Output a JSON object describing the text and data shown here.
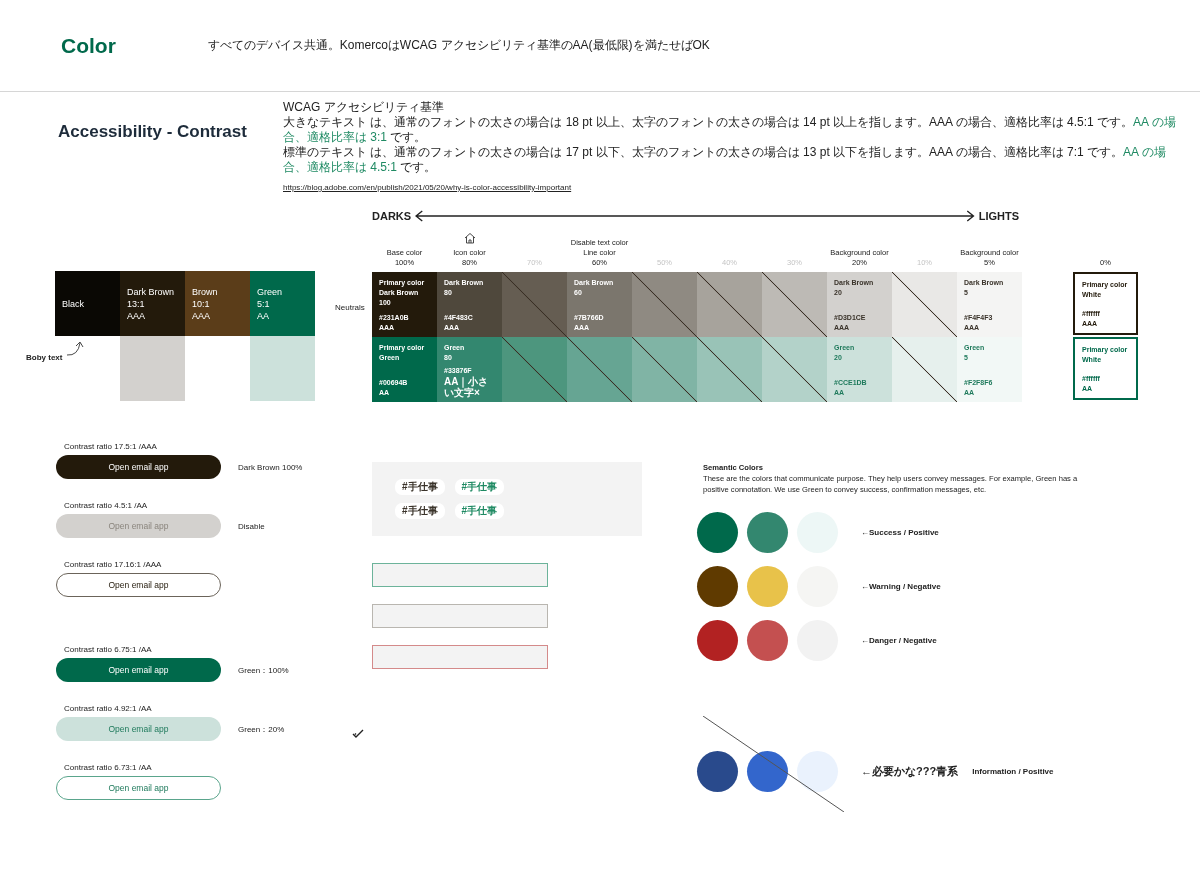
{
  "header": {
    "title": "Color",
    "note": "すべてのデバイス共通。KomercoはWCAG アクセシビリティ基準のAA(最低限)を満たせばOK"
  },
  "section_title": "Accessibility - Contrast",
  "wcag": {
    "heading": "WCAG アクセシビリティ基準",
    "lines": [
      {
        "text": "大きなテキスト は、通常のフォントの太さの場合は 18 pt 以上、太字のフォントの太さの場合は 14 pt 以上を指します。AAA の場合、適格比率は 4.5:1 です。",
        "highlight": "AA の場合、適格比率は 3:1",
        "tail": " です。"
      },
      {
        "text": "標準のテキスト は、通常のフォントの太さの場合は 17 pt 以下、太字のフォントの太さの場合は 13 pt 以下を指します。AAA の場合、適格比率は 7:1 です。",
        "highlight": "AA の場合、適格比率は 4.5:1",
        "tail": " です。"
      }
    ],
    "link": "https://blog.adobe.com/en/publish/2021/05/20/why-is-color-accessibility-important"
  },
  "scale": {
    "start": "DARKS",
    "end": "LIGHTS"
  },
  "swatches": [
    {
      "lines": [
        "Black"
      ],
      "color": "#0a0804"
    },
    {
      "lines": [
        "Dark Brown",
        "13:1",
        "AAA"
      ],
      "color": "#231a0b",
      "tint": {
        "color": "#d3d1ce"
      }
    },
    {
      "lines": [
        "Brown",
        "10:1",
        "AAA"
      ],
      "color": "#5b3d19"
    },
    {
      "lines": [
        "Green",
        "5:1",
        "AA"
      ],
      "color": "#00694b",
      "tint": {
        "color": "#cce1db"
      }
    }
  ],
  "annotation": "Boby text",
  "palette": {
    "row_label": "Neutrals",
    "columns": [
      {
        "heading": [
          "Base color",
          "100%"
        ],
        "faint": false,
        "icon": false,
        "cells": [
          {
            "color": "#231a0b",
            "kind": "light",
            "crossed": false,
            "name": [
              "Primary color",
              "Dark Brown",
              "100"
            ],
            "code": [
              "#231A0B",
              "AAA"
            ]
          },
          {
            "color": "#00694b",
            "kind": "light",
            "crossed": false,
            "name": [
              "Primary color",
              "Green"
            ],
            "code": [
              "#00694B",
              "AA"
            ]
          }
        ]
      },
      {
        "heading": [
          "Icon color",
          "80%"
        ],
        "faint": false,
        "icon": true,
        "cells": [
          {
            "color": "#4f483c",
            "kind": "light",
            "crossed": false,
            "name": [
              "Dark Brown",
              "80"
            ],
            "code": [
              "#4F483C",
              "AAA"
            ]
          },
          {
            "color": "#33876f",
            "kind": "light",
            "crossed": false,
            "name": [
              "Green",
              "80"
            ],
            "code": [
              "#33876F",
              "AA｜小さい文字×"
            ]
          }
        ]
      },
      {
        "heading": [
          "70%"
        ],
        "faint": true,
        "icon": false,
        "cells": [
          {
            "color": "#655d52",
            "kind": "light",
            "crossed": true
          },
          {
            "color": "#4d967e",
            "kind": "light",
            "crossed": true
          }
        ]
      },
      {
        "heading": [
          "Disable text color",
          "Line color",
          "60%"
        ],
        "faint": false,
        "icon": false,
        "cells": [
          {
            "color": "#7b766d",
            "kind": "light",
            "crossed": false,
            "name": [
              "Dark Brown",
              "60"
            ],
            "code": [
              "#7B766D",
              "AAA"
            ]
          },
          {
            "color": "#66a593",
            "kind": "light",
            "crossed": true
          }
        ]
      },
      {
        "heading": [
          "50%"
        ],
        "faint": true,
        "icon": false,
        "cells": [
          {
            "color": "#8f8a82",
            "kind": "light",
            "crossed": true
          },
          {
            "color": "#80b4a5",
            "kind": "light",
            "crossed": true
          }
        ]
      },
      {
        "heading": [
          "40%"
        ],
        "faint": true,
        "icon": false,
        "cells": [
          {
            "color": "#a7a39c",
            "kind": "light",
            "crossed": true
          },
          {
            "color": "#99c3b7",
            "kind": "light",
            "crossed": true
          }
        ]
      },
      {
        "heading": [
          "30%"
        ],
        "faint": true,
        "icon": false,
        "cells": [
          {
            "color": "#bdbab5",
            "kind": "light",
            "crossed": true
          },
          {
            "color": "#b3d2c9",
            "kind": "light",
            "crossed": true
          }
        ]
      },
      {
        "heading": [
          "Background color",
          "20%"
        ],
        "faint": false,
        "icon": false,
        "cells": [
          {
            "color": "#d3d1ce",
            "kind": "dark",
            "crossed": false,
            "name": [
              "Dark Brown",
              "20"
            ],
            "code": [
              "#D3D1CE",
              "AAA"
            ]
          },
          {
            "color": "#cce1db",
            "kind": "green",
            "crossed": false,
            "name": [
              "Green",
              "20"
            ],
            "code": [
              "#CCE1DB",
              "AA"
            ]
          }
        ]
      },
      {
        "heading": [
          "10%"
        ],
        "faint": true,
        "icon": false,
        "cells": [
          {
            "color": "#e9e8e6",
            "kind": "dark",
            "crossed": true
          },
          {
            "color": "#e6f0ed",
            "kind": "dark",
            "crossed": true
          }
        ]
      },
      {
        "heading": [
          "Background color",
          "5%"
        ],
        "faint": false,
        "icon": false,
        "cells": [
          {
            "color": "#f4f4f3",
            "kind": "dark",
            "crossed": false,
            "name": [
              "Dark Brown",
              "5"
            ],
            "code": [
              "#F4F4F3",
              "AAA"
            ]
          },
          {
            "color": "#f2f8f6",
            "kind": "green",
            "crossed": false,
            "name": [
              "Green",
              "5"
            ],
            "code": [
              "#F2F8F6",
              "AA"
            ]
          }
        ]
      }
    ],
    "white": {
      "heading": "0%",
      "cells": [
        {
          "color": "#231a0b",
          "name": [
            "Primary color",
            "White"
          ],
          "code": [
            "#ffffff",
            "AAA"
          ]
        },
        {
          "color": "#00694b",
          "name": [
            "Primary color",
            "White"
          ],
          "code": [
            "#ffffff",
            "AA"
          ]
        }
      ]
    }
  },
  "button_groups": [
    [
      {
        "caption": "Contrast ratio 17.5:1 /AAA",
        "label": "Open email app",
        "kind": "dark",
        "note": "Dark Brown 100%"
      },
      {
        "caption": "Contrast ratio 4.5:1 /AA",
        "label": "Open email app",
        "kind": "disabled",
        "note": "Disable"
      },
      {
        "caption": "Contrast ratio 17.16:1 /AAA",
        "label": "Open email app",
        "kind": "outline"
      }
    ],
    [
      {
        "caption": "Contrast ratio 6.75:1 /AA",
        "label": "Open email app",
        "kind": "green",
        "note": "Green：100%"
      },
      {
        "caption": "Contrast ratio 4.92:1 /AA",
        "label": "Open email app",
        "kind": "green-light",
        "note": "Green：20%"
      },
      {
        "caption": "Contrast ratio 6.73:1 /AA",
        "label": "Open email app",
        "kind": "green-outline"
      }
    ]
  ],
  "tags": [
    [
      {
        "text": "#手仕事",
        "kind": "dark"
      },
      {
        "text": "#手仕事",
        "kind": "green"
      }
    ],
    [
      {
        "text": "#手仕事",
        "kind": "dark"
      },
      {
        "text": "#手仕事",
        "kind": "green"
      }
    ]
  ],
  "fields": [
    {
      "kind": "focus"
    },
    {
      "kind": "default"
    },
    {
      "kind": "error"
    }
  ],
  "semantic": {
    "title": "Semantic Colors",
    "description": "These are the colors that communicate purpose. They help users convey messages. For example, Green has a positive connotation. We use Green to convey success, confirmation messages, etc.",
    "rows": [
      {
        "colors": [
          {
            "color": "#00694b"
          },
          {
            "color": "#33876f"
          },
          {
            "color": "#edf7f6"
          }
        ],
        "labels": [
          "←Success / Positive"
        ],
        "struck": false
      },
      {
        "colors": [
          {
            "color": "#5f3a00"
          },
          {
            "color": "#e8c24a"
          },
          {
            "color": "#f5f5f3"
          }
        ],
        "labels": [
          "←Warning / Negative"
        ],
        "struck": false
      },
      {
        "colors": [
          {
            "color": "#b22222"
          },
          {
            "color": "#c45050"
          },
          {
            "color": "#f2f2f2"
          }
        ],
        "labels": [
          "←Danger / Negative"
        ],
        "struck": false
      },
      {
        "colors": [
          {
            "color": "#294a8c"
          },
          {
            "color": "#3366cc"
          },
          {
            "color": "#eaf2fd"
          }
        ],
        "labels": [
          "←必要かな???青系",
          "Information / Positive"
        ],
        "struck": true
      }
    ]
  }
}
